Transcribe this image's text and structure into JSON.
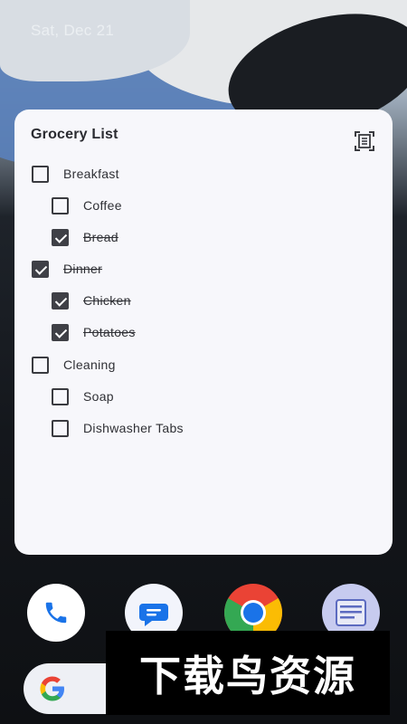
{
  "status": {
    "date": "Sat, Dec 21"
  },
  "widget": {
    "title": "Grocery List",
    "action_icon": "list-expand-icon",
    "items": [
      {
        "label": "Breakfast",
        "checked": false,
        "level": 0
      },
      {
        "label": "Coffee",
        "checked": false,
        "level": 1
      },
      {
        "label": "Bread",
        "checked": true,
        "level": 1
      },
      {
        "label": "Dinner",
        "checked": true,
        "level": 0
      },
      {
        "label": "Chicken",
        "checked": true,
        "level": 1
      },
      {
        "label": "Potatoes",
        "checked": true,
        "level": 1
      },
      {
        "label": "Cleaning",
        "checked": false,
        "level": 0
      },
      {
        "label": "Soap",
        "checked": false,
        "level": 1
      },
      {
        "label": "Dishwasher Tabs",
        "checked": false,
        "level": 1
      }
    ]
  },
  "dock": {
    "apps": [
      "phone-icon",
      "messages-icon",
      "chrome-icon",
      "notes-icon"
    ]
  },
  "search": {
    "icon": "google-g-icon"
  },
  "watermark": {
    "text": "下载鸟资源"
  },
  "colors": {
    "widget_bg": "#f7f7fb",
    "checkbox_fill": "#3f4046",
    "phone_blue": "#1a73e8",
    "messages_blue": "#1a73e8"
  }
}
